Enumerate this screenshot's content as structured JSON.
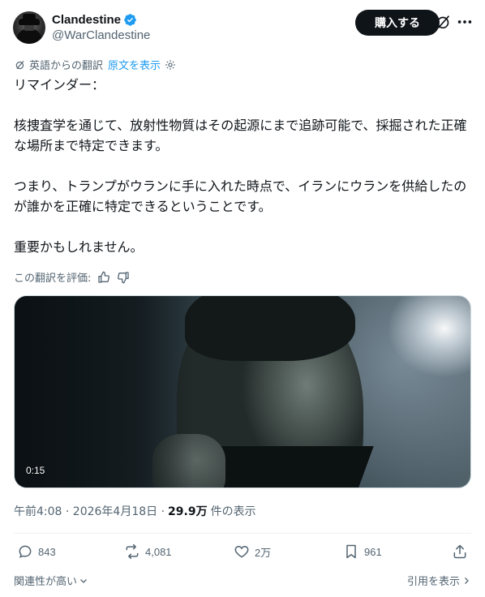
{
  "author": {
    "display_name": "Clandestine",
    "handle": "@WarClandestine",
    "verified_color": "#1d9bf0"
  },
  "header": {
    "buy_label": "購入する",
    "grok_icon": "grok-icon",
    "more_icon": "more-dots-icon"
  },
  "translation": {
    "label": "英語からの翻訳",
    "show_original": "原文を表示",
    "rate_label": "この翻訳を評価:"
  },
  "tweet": {
    "p1": "リマインダー：",
    "p2": "核捜査学を通じて、放射性物質はその起源にまで追跡可能で、採掘された正確な場所まで特定できます。",
    "p3": "つまり、トランプがウランに手に入れた時点で、イランにウランを供給したのが誰かを正確に特定できるということです。",
    "p4": "重要かもしれません。"
  },
  "video": {
    "duration": "0:15"
  },
  "meta": {
    "timestamp": "午前4:08 · 2026年4月18日 · ",
    "views_count": "29.9万",
    "views_label": "件の表示"
  },
  "actions": {
    "replies": "843",
    "reposts": "4,081",
    "likes": "2万",
    "bookmarks": "961"
  },
  "footer": {
    "relevance": "関連性が高い",
    "quotes": "引用を表示"
  },
  "colors": {
    "text": "#0f1419",
    "secondary": "#536471",
    "accent": "#1d9bf0"
  }
}
